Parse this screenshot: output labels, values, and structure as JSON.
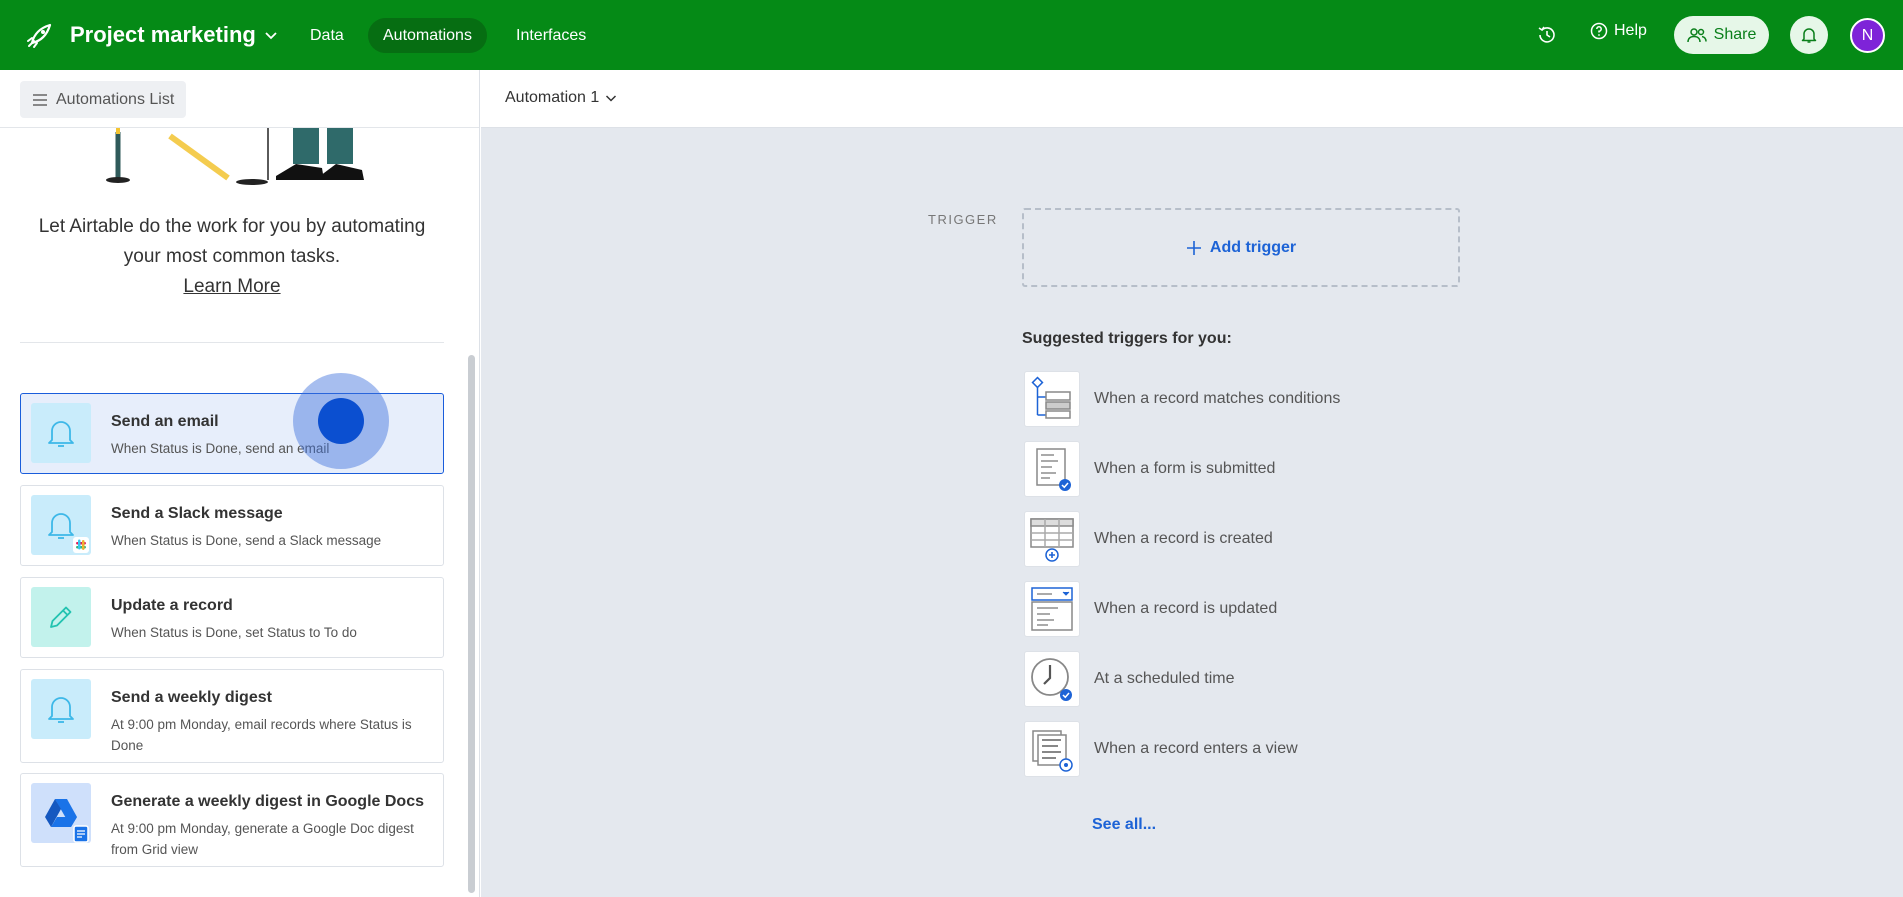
{
  "topbar": {
    "base_name": "Project marketing",
    "tabs": [
      {
        "label": "Data",
        "active": false
      },
      {
        "label": "Automations",
        "active": true
      },
      {
        "label": "Interfaces",
        "active": false
      }
    ],
    "help_label": "Help",
    "share_label": "Share",
    "avatar_initial": "N",
    "colors": {
      "bar": "#058a16",
      "avatar": "#7e23d8"
    }
  },
  "sidebar": {
    "list_button": "Automations List",
    "promo_text": "Let Airtable do the work for you by automating your most common tasks.",
    "learn_more": "Learn More",
    "cards": [
      {
        "title": "Send an email",
        "desc": "When Status is Done, send an email",
        "icon": "bell-icon",
        "selected": true
      },
      {
        "title": "Send a Slack message",
        "desc": "When Status is Done, send a Slack message",
        "icon": "bell-slack-icon",
        "selected": false
      },
      {
        "title": "Update a record",
        "desc": "When Status is Done, set Status to To do",
        "icon": "pencil-icon",
        "selected": false
      },
      {
        "title": "Send a weekly digest",
        "desc": "At 9:00 pm Monday, email records where Status is Done",
        "icon": "bell-icon",
        "selected": false
      },
      {
        "title": "Generate a weekly digest in Google Docs",
        "desc": "At 9:00 pm Monday, generate a Google Doc digest from Grid view",
        "icon": "google-drive-icon",
        "selected": false
      }
    ]
  },
  "main": {
    "automation_name": "Automation 1",
    "trigger_label": "TRIGGER",
    "add_trigger": "Add trigger",
    "suggest_title": "Suggested triggers for you:",
    "suggestions": [
      {
        "label": "When a record matches conditions",
        "icon": "conditions-icon"
      },
      {
        "label": "When a form is submitted",
        "icon": "form-icon"
      },
      {
        "label": "When a record is created",
        "icon": "grid-add-icon"
      },
      {
        "label": "When a record is updated",
        "icon": "record-update-icon"
      },
      {
        "label": "At a scheduled time",
        "icon": "clock-icon"
      },
      {
        "label": "When a record enters a view",
        "icon": "view-icon"
      }
    ],
    "see_all": "See all..."
  }
}
